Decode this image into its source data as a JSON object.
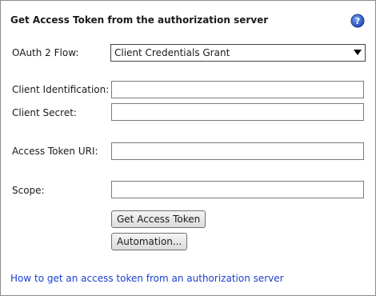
{
  "panel": {
    "title": "Get Access Token from the authorization server",
    "help_icon": "help-icon"
  },
  "form": {
    "flow_label": "OAuth 2 Flow:",
    "flow_value": "Client Credentials Grant",
    "client_id_label": "Client Identification:",
    "client_id_value": "",
    "client_secret_label": "Client Secret:",
    "client_secret_value": "",
    "token_uri_label": "Access Token URI:",
    "token_uri_value": "",
    "scope_label": "Scope:",
    "scope_value": ""
  },
  "buttons": {
    "get_token": "Get Access Token",
    "automation": "Automation..."
  },
  "footer": {
    "help_link": "How to get an access token from an authorization server"
  },
  "colors": {
    "link": "#1a3fd0",
    "help_icon_fill": "#2e5fc9"
  }
}
